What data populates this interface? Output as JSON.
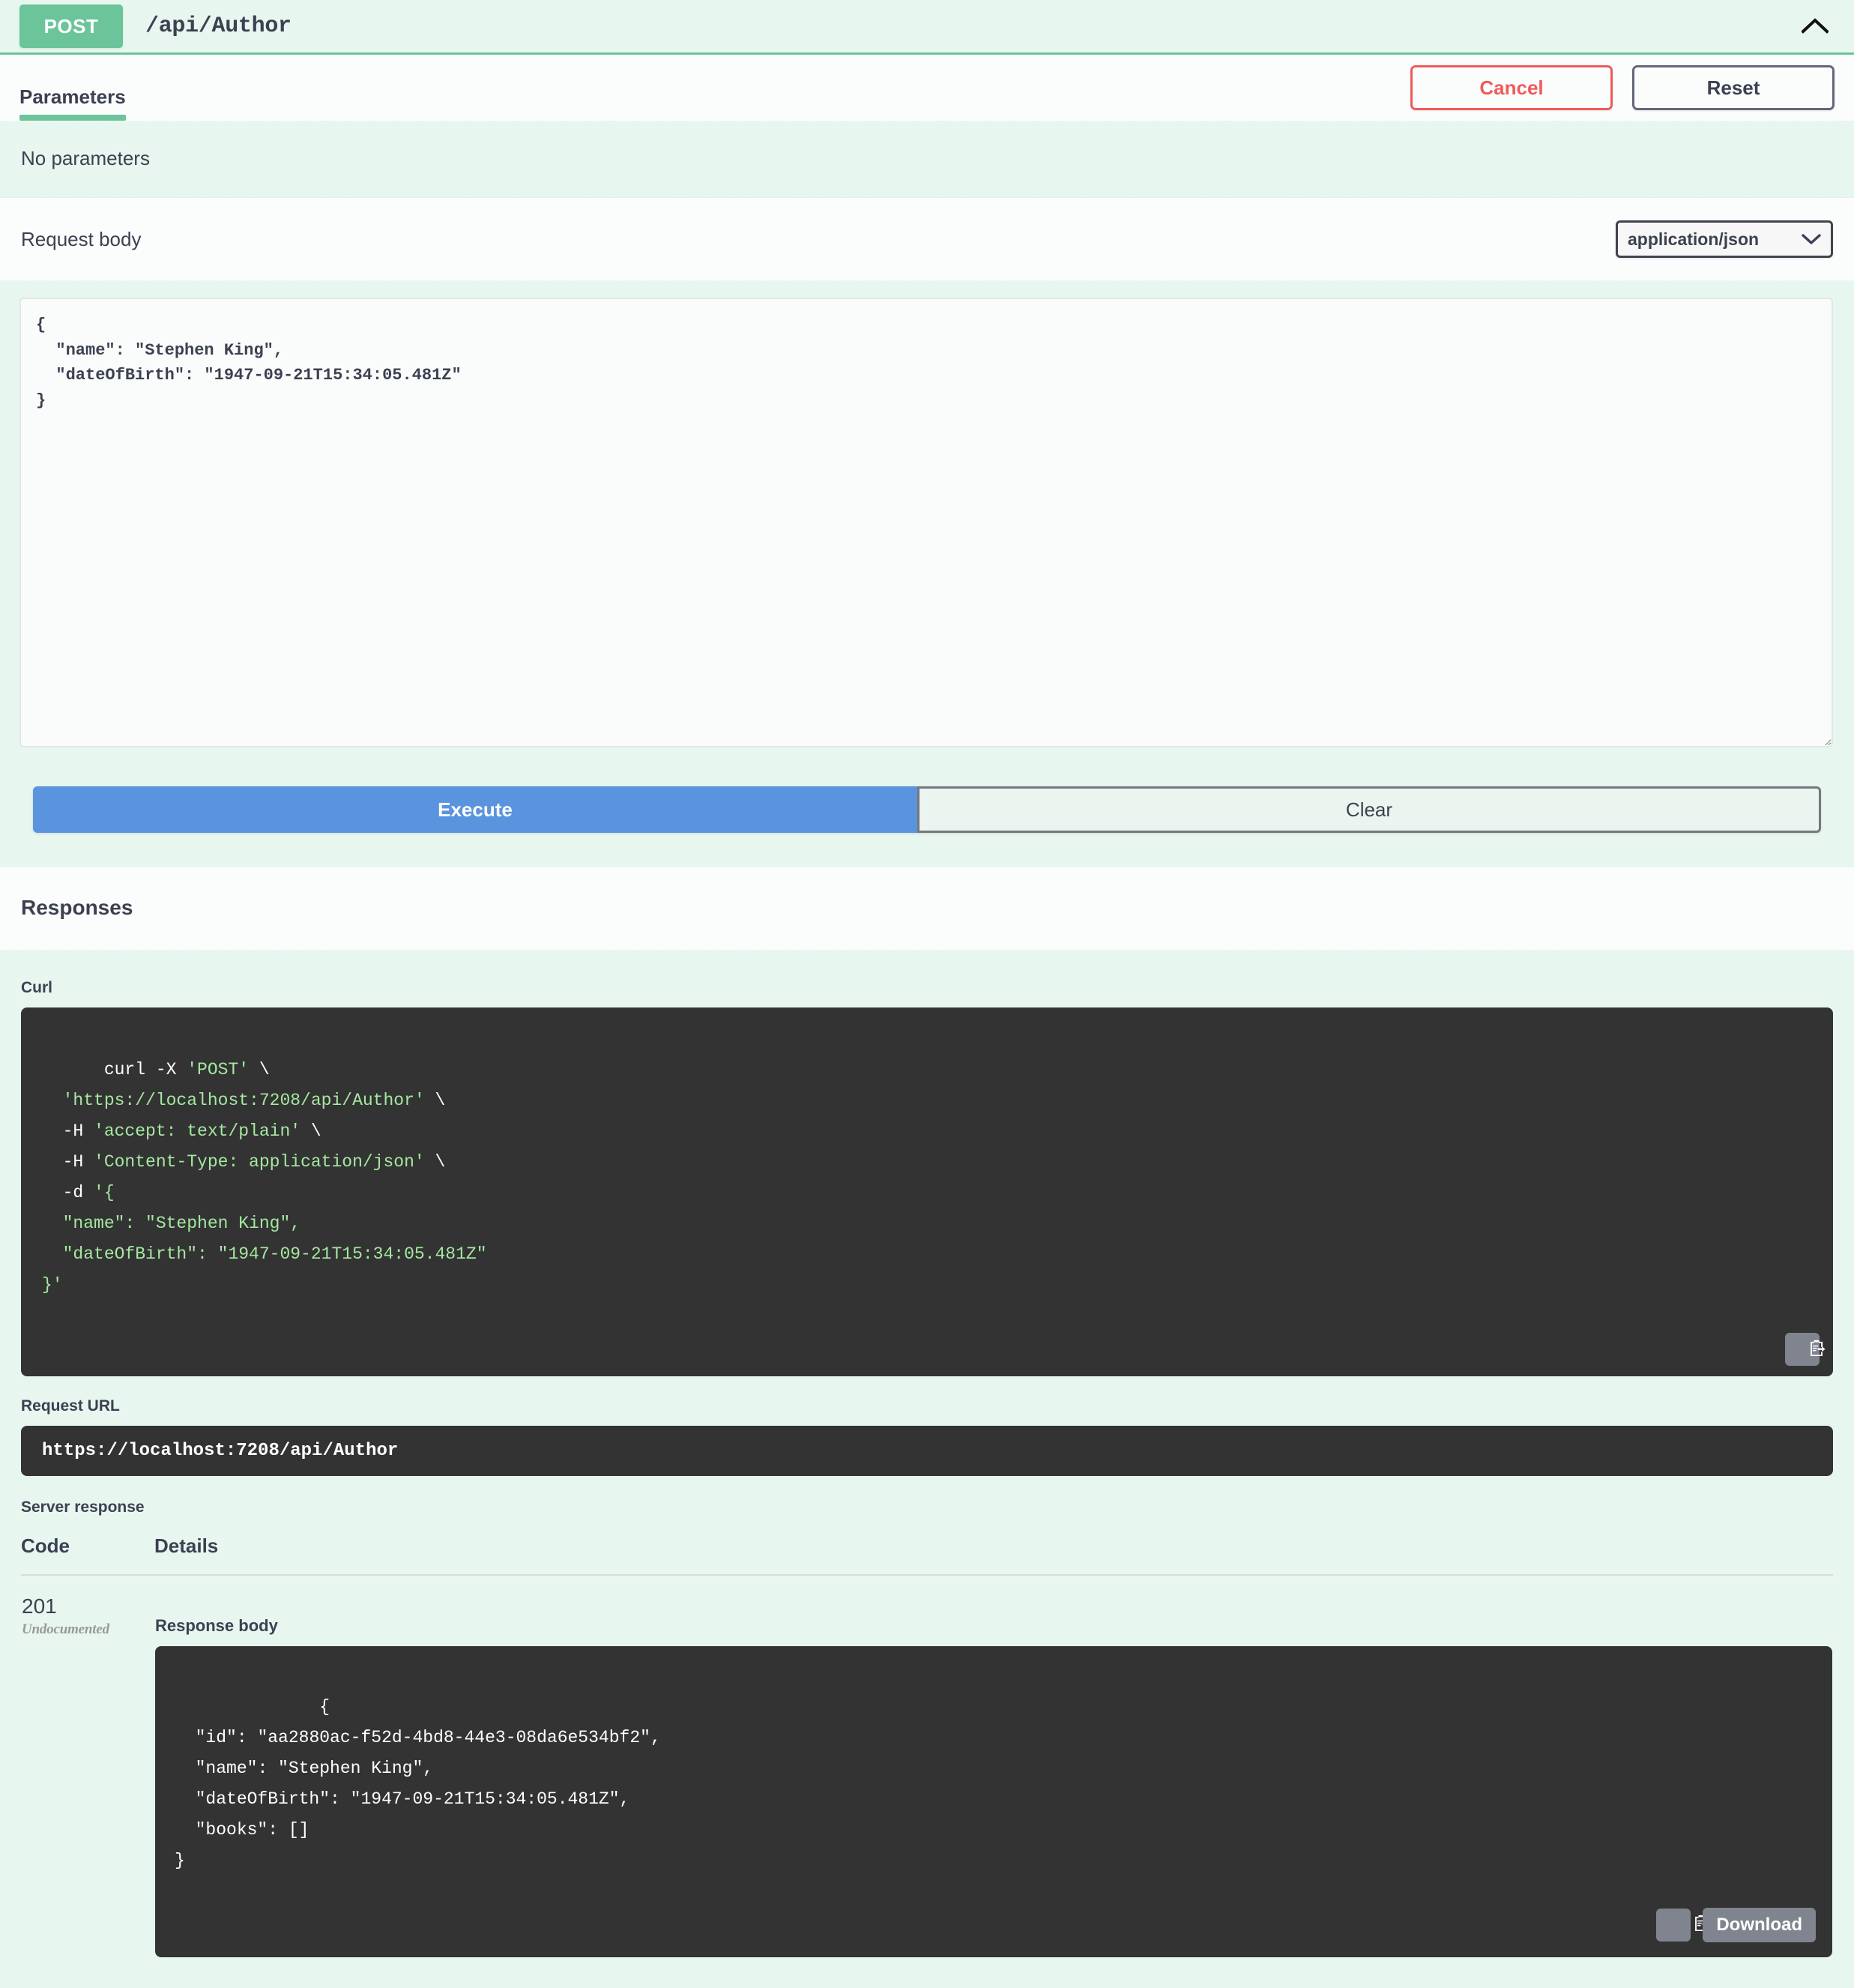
{
  "operation": {
    "method": "POST",
    "path": "/api/Author",
    "collapse_icon": "chevron-up-icon"
  },
  "tabs": [
    {
      "label": "Parameters",
      "active": true
    }
  ],
  "actions": {
    "cancel_label": "Cancel",
    "reset_label": "Reset"
  },
  "parameters": {
    "empty_text": "No parameters"
  },
  "request_body": {
    "label": "Request body",
    "media_type_selected": "application/json",
    "media_type_options": [
      "application/json"
    ],
    "chevron_icon": "chevron-down-icon",
    "editor_value": "{\n  \"name\": \"Stephen King\",\n  \"dateOfBirth\": \"1947-09-21T15:34:05.481Z\"\n}",
    "editor_placeholder": ""
  },
  "execute_bar": {
    "execute_label": "Execute",
    "clear_label": "Clear"
  },
  "responses": {
    "title": "Responses",
    "curl": {
      "label": "Curl",
      "lines": [
        {
          "text": "curl -X ",
          "green": false
        },
        {
          "text": "'POST'",
          "green": true
        },
        {
          "text": " \\\n  ",
          "green": false
        },
        {
          "text": "'https://localhost:7208/api/Author'",
          "green": true
        },
        {
          "text": " \\\n  -H ",
          "green": false
        },
        {
          "text": "'accept: text/plain'",
          "green": true
        },
        {
          "text": " \\\n  -H ",
          "green": false
        },
        {
          "text": "'Content-Type: application/json'",
          "green": true
        },
        {
          "text": " \\\n  -d ",
          "green": false
        },
        {
          "text": "'{\n  \"name\": \"Stephen King\",\n  \"dateOfBirth\": \"1947-09-21T15:34:05.481Z\"\n}'",
          "green": true
        }
      ],
      "copy_icon": "copy-to-clipboard-icon"
    },
    "request_url": {
      "label": "Request URL",
      "value": "https://localhost:7208/api/Author"
    },
    "server_response": {
      "label": "Server response",
      "columns": [
        "Code",
        "Details"
      ],
      "rows": [
        {
          "code": "201",
          "code_note": "Undocumented",
          "details_label": "Response body",
          "body_segments": [
            {
              "text": "{\n  ",
              "green": false
            },
            {
              "text": "\"id\"",
              "green": false
            },
            {
              "text": ": ",
              "green": false
            },
            {
              "text": "\"aa2880ac-f52d-4bd8-44e3-08da6e534bf2\"",
              "green": true
            },
            {
              "text": ",\n  ",
              "green": false
            },
            {
              "text": "\"name\"",
              "green": false
            },
            {
              "text": ": ",
              "green": false
            },
            {
              "text": "\"Stephen King\"",
              "green": true
            },
            {
              "text": ",\n  ",
              "green": false
            },
            {
              "text": "\"dateOfBirth\"",
              "green": false
            },
            {
              "text": ": ",
              "green": false
            },
            {
              "text": "\"1947-09-21T15:34:05.481Z\"",
              "green": true
            },
            {
              "text": ",\n  ",
              "green": false
            },
            {
              "text": "\"books\"",
              "green": false
            },
            {
              "text": ": []\n}",
              "green": false
            }
          ],
          "copy_icon": "copy-to-clipboard-icon",
          "download_label": "Download"
        }
      ]
    }
  },
  "colors": {
    "method_post": "#6bc49a",
    "accent_green": "#6bc49a",
    "execute_blue": "#5a94de",
    "cancel_red": "#ef5b5b",
    "code_bg": "#333333",
    "code_string_green": "#a5e8a0",
    "band_green": "#e8f6f0",
    "text_dark": "#3b4151"
  }
}
